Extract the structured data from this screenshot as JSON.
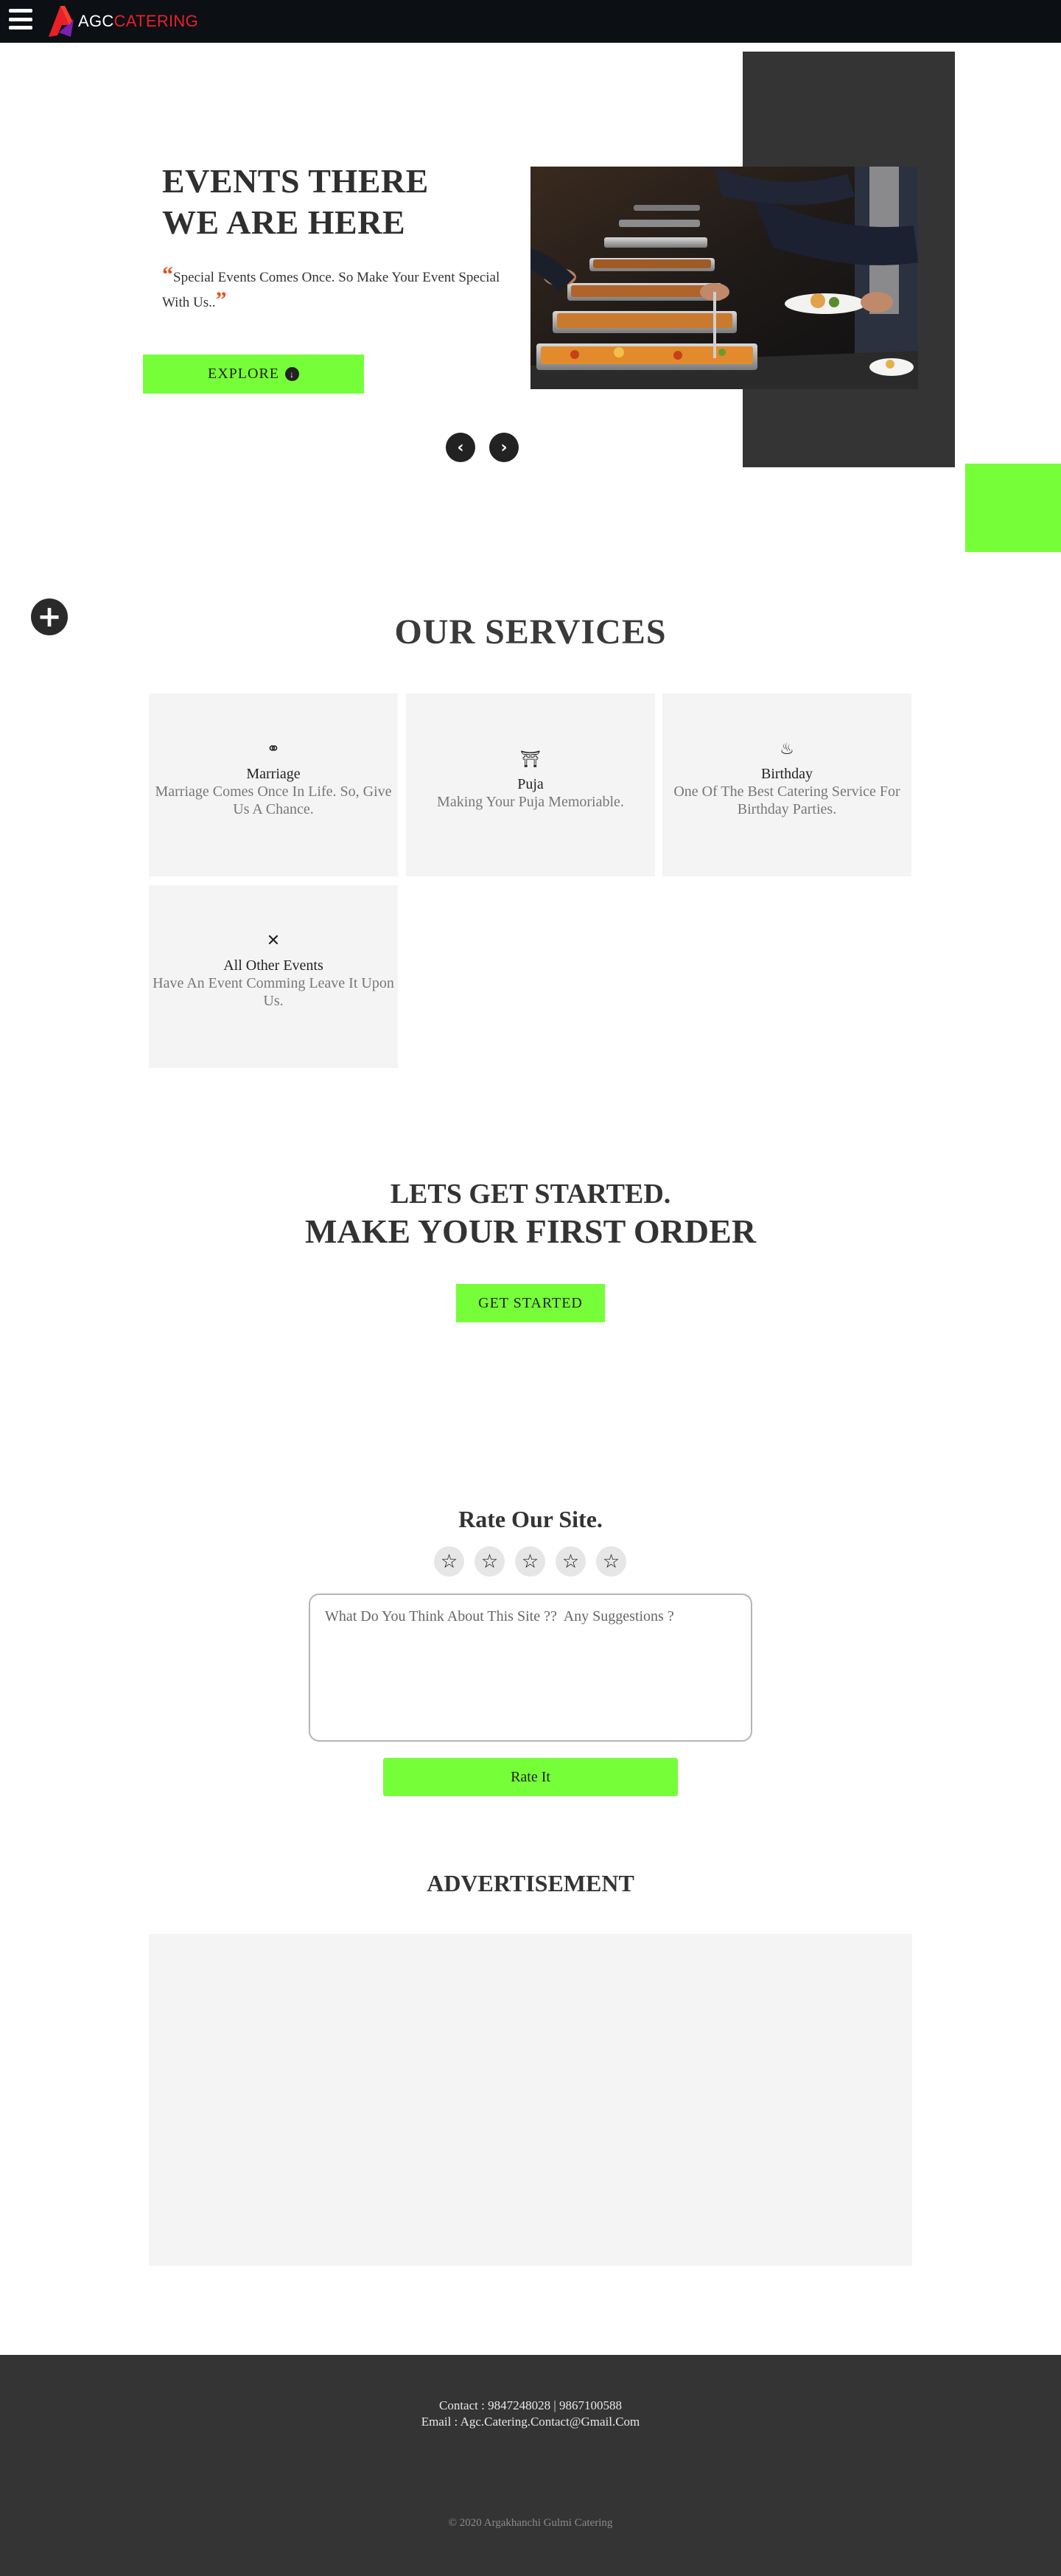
{
  "nav": {
    "menu_icon": "hamburger-menu-icon",
    "logo_icon": "agc-logo-mark",
    "logo_agc": "AGC",
    "logo_catering": "CATERING"
  },
  "hero": {
    "title_line1": "EVENTS THERE",
    "title_line2": "WE ARE HERE",
    "quote_open": "“",
    "quote": "Special Events Comes Once. So Make Your Event Special With Us..",
    "quote_close": "”",
    "explore_label": "EXPLORE",
    "explore_icon": "arrow-circle-down-icon",
    "prev_icon": "chevron-left-icon",
    "next_icon": "chevron-right-icon",
    "image_subject": "catering-buffet-photo"
  },
  "floating": {
    "plus_icon": "plus-circle-icon"
  },
  "services": {
    "title": "OUR SERVICES",
    "cards": [
      {
        "icon": "rings-icon",
        "title": "Marriage",
        "desc": "Marriage Comes Once In Life. So, Give Us A Chance."
      },
      {
        "icon": "temple-icon",
        "title": "Puja",
        "desc": "Making Your Puja Memoriable."
      },
      {
        "icon": "birthday-cake-icon",
        "title": "Birthday",
        "desc": "One Of The Best Catering Service For Birthday Parties."
      },
      {
        "icon": "utensils-icon",
        "title": "All Other Events",
        "desc": "Have An Event Comming Leave It Upon Us."
      }
    ]
  },
  "cta": {
    "line1": "LETS GET STARTED.",
    "line2": "MAKE YOUR FIRST ORDER",
    "button": "GET STARTED"
  },
  "rating": {
    "title": "Rate Our Site.",
    "star_icon": "star-outline-icon",
    "star_count": 5,
    "placeholder": "What Do You Think About This Site ??  Any Suggestions ?",
    "button": "Rate It"
  },
  "ad": {
    "title": "ADVERTISEMENT"
  },
  "footer": {
    "contact": "Contact : 9847248028 | 9867100588",
    "email": "Email : Agc.Catering.Contact@Gmail.Com",
    "copyright": "© 2020 Argakhanchi Gulmi Catering"
  },
  "colors": {
    "accent_green": "#76ff39",
    "dark": "#343434",
    "navbar": "#0c1014",
    "logo_red": "#e8202a"
  }
}
